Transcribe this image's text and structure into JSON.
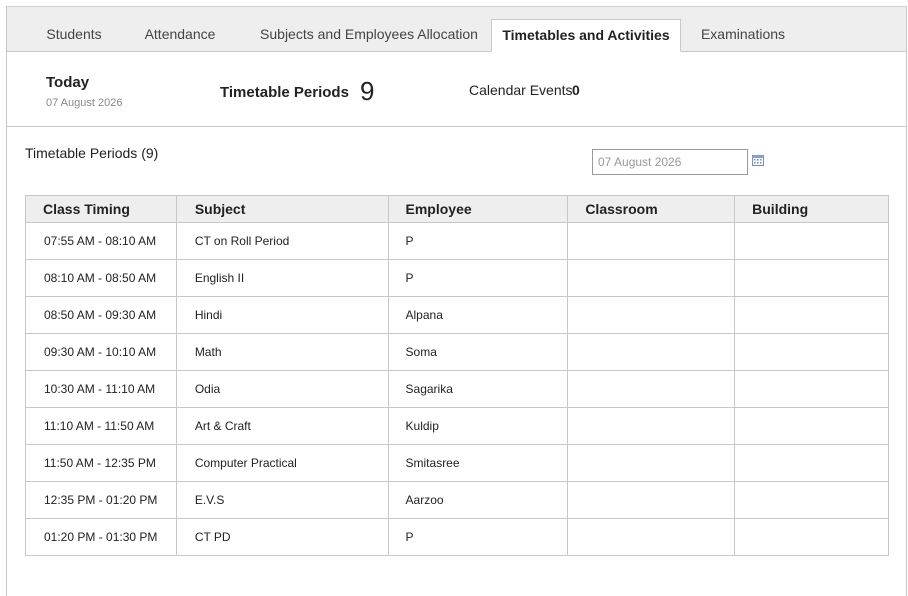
{
  "tabs": [
    {
      "label": "Students"
    },
    {
      "label": "Attendance"
    },
    {
      "label": "Subjects and Employees Allocation"
    },
    {
      "label": "Timetables and Activities"
    },
    {
      "label": "Examinations"
    }
  ],
  "summary": {
    "today_label": "Today",
    "today_date": "07 August 2026",
    "periods_label": "Timetable Periods",
    "periods_count": "9",
    "events_label": "Calendar Events",
    "events_count": "0"
  },
  "section": {
    "title": "Timetable Periods (9)",
    "date_value": "07 August 2026"
  },
  "table": {
    "headers": [
      "Class Timing",
      "Subject",
      "Employee",
      "Classroom",
      "Building"
    ],
    "rows": [
      [
        "07:55 AM - 08:10 AM",
        "CT on Roll Period",
        "P",
        "",
        ""
      ],
      [
        "08:10 AM - 08:50 AM",
        "English II",
        "P",
        "",
        ""
      ],
      [
        "08:50 AM - 09:30 AM",
        "Hindi",
        "Alpana",
        "",
        ""
      ],
      [
        "09:30 AM - 10:10 AM",
        "Math",
        "Soma",
        "",
        ""
      ],
      [
        "10:30 AM - 11:10 AM",
        "Odia",
        "Sagarika",
        "",
        ""
      ],
      [
        "11:10 AM - 11:50 AM",
        "Art & Craft",
        "Kuldip",
        "",
        ""
      ],
      [
        "11:50 AM - 12:35 PM",
        "Computer Practical",
        "Smitasree",
        "",
        ""
      ],
      [
        "12:35 PM - 01:20 PM",
        "E.V.S",
        "Aarzoo",
        "",
        ""
      ],
      [
        "01:20 PM - 01:30 PM",
        "CT PD",
        "P",
        "",
        ""
      ]
    ]
  },
  "icons": {
    "calendar": "calendar-icon"
  },
  "colors": {
    "tab_bar_bg": "#eeeeee",
    "border": "#c8c8c8",
    "header_bg": "#eeeeee"
  }
}
